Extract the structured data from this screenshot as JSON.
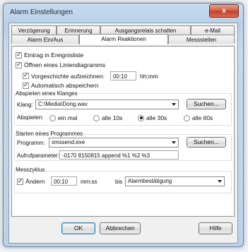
{
  "window": {
    "title": "Alarm Einstellungen",
    "close_label": "x"
  },
  "tabs": {
    "row1": [
      "Verzögerung",
      "Erinnerung",
      "Ausgangsrelais schalten",
      "e-Mail"
    ],
    "row2": [
      "Alarm Ein/Aus",
      "Alarm Reaktionen",
      "Messstellen"
    ],
    "active": "Alarm Reaktionen"
  },
  "reactions": {
    "eintrag_label": "Eintrag in Ereignisliste",
    "eintrag_checked": true,
    "oeffnen_label": "Öffnen eines Liniendiagramms",
    "oeffnen_checked": true,
    "vorgeschichte_label": "Vorgeschichte aufzeichnen:",
    "vorgeschichte_checked": true,
    "vorgeschichte_value": "00:10",
    "vorgeschichte_unit": "hh:mm",
    "abspeichern_label": "Automatisch abspeichern",
    "abspeichern_checked": true
  },
  "sound": {
    "group_label": "Abspielen eines Klanges",
    "klang_label": "Klang:",
    "klang_value": "C:\\Media\\Dong.wav",
    "suchen_label": "Suchen...",
    "abspielen_label": "Abspielen:",
    "options": [
      "ein mal",
      "alle 10s",
      "alle 30s",
      "alle 60s"
    ],
    "selected": "alle 30s"
  },
  "program": {
    "group_label": "Starten eines Programmes",
    "programm_label": "Programm:",
    "programm_value": "smssend.exe",
    "suchen_label": "Suchen...",
    "param_label": "Aufrufparameter:",
    "param_value": "-0170 8150815 append %1 %2 %3"
  },
  "cycle": {
    "group_label": "Messzyklus",
    "aendern_label": "Ändern",
    "aendern_checked": true,
    "value": "00:10",
    "unit": "mm:ss",
    "bis_label": "bis",
    "bis_value": "Alarmbestätigung"
  },
  "buttons": {
    "ok": "OK",
    "cancel": "Abbrechen",
    "help": "Hilfe"
  }
}
